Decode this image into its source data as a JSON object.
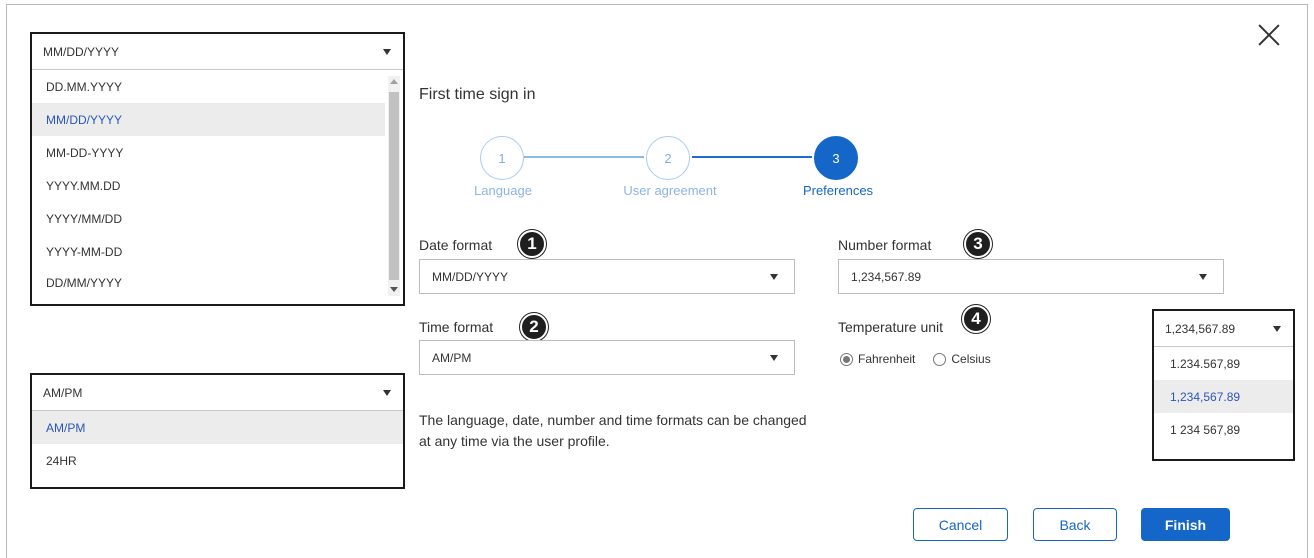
{
  "dialog": {
    "title": "First time sign in",
    "close_icon": "close-icon"
  },
  "stepper": {
    "steps": [
      {
        "number": "1",
        "label": "Language"
      },
      {
        "number": "2",
        "label": "User agreement"
      },
      {
        "number": "3",
        "label": "Preferences"
      }
    ],
    "active_step": 3
  },
  "form": {
    "date_format": {
      "label": "Date format",
      "value": "MM/DD/YYYY",
      "callout": "1"
    },
    "time_format": {
      "label": "Time format",
      "value": "AM/PM",
      "callout": "2"
    },
    "number_format": {
      "label": "Number format",
      "value": "1,234,567.89",
      "callout": "3"
    },
    "temperature_unit": {
      "label": "Temperature unit",
      "callout": "4",
      "options": [
        "Fahrenheit",
        "Celsius"
      ],
      "selected": "Fahrenheit"
    },
    "note": "The language, date, number and time formats can be changed at any time via the user profile."
  },
  "buttons": {
    "cancel": "Cancel",
    "back": "Back",
    "finish": "Finish"
  },
  "date_dropdown": {
    "value": "MM/DD/YYYY",
    "options": [
      "DD.MM.YYYY",
      "MM/DD/YYYY",
      "MM-DD-YYYY",
      "YYYY.MM.DD",
      "YYYY/MM/DD",
      "YYYY-MM-DD",
      "DD/MM/YYYY"
    ],
    "selected": "MM/DD/YYYY"
  },
  "time_dropdown": {
    "value": "AM/PM",
    "options": [
      "AM/PM",
      "24HR"
    ],
    "selected": "AM/PM"
  },
  "number_dropdown": {
    "value": "1,234,567.89",
    "options": [
      "1.234.567,89",
      "1,234,567.89",
      "1 234 567,89"
    ],
    "selected": "1,234,567.89"
  },
  "colors": {
    "accent": "#1466c8",
    "selected_option_text": "#2c55b8",
    "callout_badge": "#1f1f1f"
  }
}
